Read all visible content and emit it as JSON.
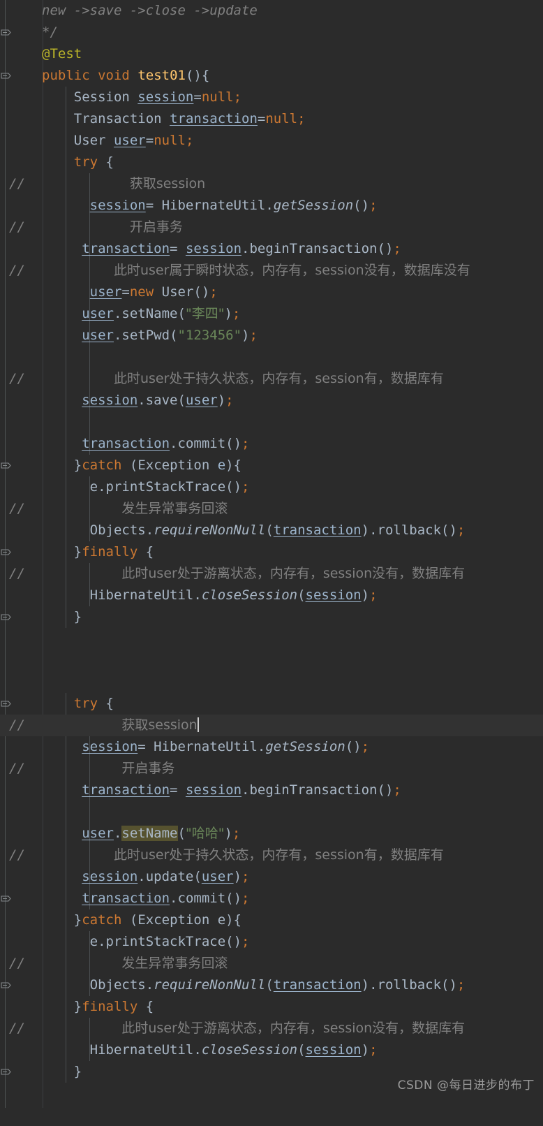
{
  "editor": {
    "theme": "darcula",
    "background": "#2b2b2b",
    "caret_line_background": "#323232",
    "gutter_background": "#2b2b2b",
    "colors": {
      "keyword": "#cc7832",
      "annotation": "#bbb529",
      "method_declaration": "#ffc66d",
      "string": "#6a8759",
      "comment": "#808080",
      "local_variable": "#9cb4cc",
      "default_text": "#a9b7c6",
      "identifier_highlight": "#56522f",
      "indent_guide": "#4b4f51"
    },
    "caret": {
      "line_index": 33,
      "after_text": "获取session"
    },
    "highlighted_identifier": "setName"
  },
  "watermark": {
    "text": "CSDN @每日进步的布丁"
  },
  "comment_markers": {
    "marker": "//",
    "line_indexes": [
      8,
      10,
      12,
      17,
      23,
      26,
      34,
      36,
      39,
      43,
      47
    ]
  },
  "fold_markers": {
    "line_indexes": [
      1,
      3,
      21,
      25,
      28,
      32,
      41,
      45,
      49
    ]
  },
  "lines": [
    {
      "i": 0,
      "indent": 0,
      "plain": "new ->save ->close ->update"
    },
    {
      "i": 1,
      "indent": 0,
      "plain": "*/"
    },
    {
      "i": 2,
      "indent": 0,
      "plain": "@Test"
    },
    {
      "i": 3,
      "indent": 0,
      "plain": "public void test01(){"
    },
    {
      "i": 4,
      "indent": 1,
      "plain": "Session session=null;"
    },
    {
      "i": 5,
      "indent": 1,
      "plain": "Transaction transaction=null;"
    },
    {
      "i": 6,
      "indent": 1,
      "plain": "User user=null;"
    },
    {
      "i": 7,
      "indent": 1,
      "plain": "try {"
    },
    {
      "i": 8,
      "indent": 2,
      "plain": "        获取session"
    },
    {
      "i": 9,
      "indent": 2,
      "plain": " session= HibernateUtil.getSession();"
    },
    {
      "i": 10,
      "indent": 2,
      "plain": "        开启事务"
    },
    {
      "i": 11,
      "indent": 2,
      "plain": "transaction= session.beginTransaction();"
    },
    {
      "i": 12,
      "indent": 2,
      "plain": "      此时user属于瞬时状态，内存有，session没有，数据库没有"
    },
    {
      "i": 13,
      "indent": 2,
      "plain": " user=new User();"
    },
    {
      "i": 14,
      "indent": 2,
      "plain": "user.setName(\"李四\");"
    },
    {
      "i": 15,
      "indent": 2,
      "plain": "user.setPwd(\"123456\");"
    },
    {
      "i": 16,
      "indent": 2,
      "plain": ""
    },
    {
      "i": 17,
      "indent": 2,
      "plain": "      此时user处于持久状态，内存有，session有，数据库有"
    },
    {
      "i": 18,
      "indent": 2,
      "plain": "session.save(user);"
    },
    {
      "i": 19,
      "indent": 2,
      "plain": ""
    },
    {
      "i": 20,
      "indent": 2,
      "plain": "transaction.commit();"
    },
    {
      "i": 21,
      "indent": 1,
      "plain": "}catch (Exception e){"
    },
    {
      "i": 22,
      "indent": 2,
      "plain": "e.printStackTrace();"
    },
    {
      "i": 23,
      "indent": 2,
      "plain": "     发生异常事务回滚"
    },
    {
      "i": 24,
      "indent": 2,
      "plain": "Objects.requireNonNull(transaction).rollback();"
    },
    {
      "i": 25,
      "indent": 1,
      "plain": "}finally {"
    },
    {
      "i": 26,
      "indent": 2,
      "plain": "      此时user处于游离状态，内存有，session没有，数据库有"
    },
    {
      "i": 27,
      "indent": 2,
      "plain": "HibernateUtil.closeSession(session);"
    },
    {
      "i": 28,
      "indent": 1,
      "plain": "}"
    },
    {
      "i": 29,
      "indent": 0,
      "plain": ""
    },
    {
      "i": 30,
      "indent": 0,
      "plain": ""
    },
    {
      "i": 31,
      "indent": 0,
      "plain": ""
    },
    {
      "i": 32,
      "indent": 1,
      "plain": "try {"
    },
    {
      "i": 33,
      "indent": 2,
      "plain": "     获取session"
    },
    {
      "i": 34,
      "indent": 2,
      "plain": "session= HibernateUtil.getSession();"
    },
    {
      "i": 35,
      "indent": 2,
      "plain": "     开启事务"
    },
    {
      "i": 36,
      "indent": 2,
      "plain": "transaction= session.beginTransaction();"
    },
    {
      "i": 37,
      "indent": 2,
      "plain": ""
    },
    {
      "i": 38,
      "indent": 2,
      "plain": "user.setName(\"哈哈\");"
    },
    {
      "i": 39,
      "indent": 2,
      "plain": "     此时user处于持久状态，内存有，session有，数据库有"
    },
    {
      "i": 40,
      "indent": 2,
      "plain": "session.update(user);"
    },
    {
      "i": 41,
      "indent": 2,
      "plain": "transaction.commit();"
    },
    {
      "i": 42,
      "indent": 1,
      "plain": "}catch (Exception e){"
    },
    {
      "i": 43,
      "indent": 2,
      "plain": "e.printStackTrace();"
    },
    {
      "i": 44,
      "indent": 2,
      "plain": "     发生异常事务回滚"
    },
    {
      "i": 45,
      "indent": 2,
      "plain": "Objects.requireNonNull(transaction).rollback();"
    },
    {
      "i": 46,
      "indent": 1,
      "plain": "}finally {"
    },
    {
      "i": 47,
      "indent": 2,
      "plain": "     此时user处于游离状态，内存有，session没有，数据库有"
    },
    {
      "i": 48,
      "indent": 2,
      "plain": "HibernateUtil.closeSession(session);"
    },
    {
      "i": 49,
      "indent": 1,
      "plain": "}"
    }
  ],
  "tokens": {
    "kw_public": "public",
    "kw_void": "void",
    "kw_new": "new",
    "kw_null": "null",
    "kw_try": "try",
    "kw_catch": "catch",
    "kw_finally": "finally",
    "anno_test": "@Test",
    "method_test01": "test01",
    "type_Session": "Session",
    "type_Transaction": "Transaction",
    "type_User": "User",
    "type_Exception": "Exception",
    "cls_HibernateUtil": "HibernateUtil",
    "cls_Objects": "Objects",
    "var_session": "session",
    "var_transaction": "transaction",
    "var_user": "user",
    "var_e": "e",
    "m_getSession": "getSession",
    "m_beginTransaction": "beginTransaction",
    "m_setName": "setName",
    "m_setPwd": "setPwd",
    "m_save": "save",
    "m_update": "update",
    "m_commit": "commit",
    "m_printStackTrace": "printStackTrace",
    "m_requireNonNull": "requireNonNull",
    "m_rollback": "rollback",
    "m_closeSession": "closeSession",
    "str_lisi": "\"李四\"",
    "str_123456": "\"123456\"",
    "str_haha": "\"哈哈\"",
    "cmt_doc_flow": "new ->save ->close ->update",
    "cmt_doc_end": "*/",
    "cmt_get_session": "获取session",
    "cmt_begin_tx": "开启事务",
    "cmt_transient": "此时user属于瞬时状态，内存有，session没有，数据库没有",
    "cmt_persistent": "此时user处于持久状态，内存有，session有，数据库有",
    "cmt_rollback": "发生异常事务回滚",
    "cmt_detached": "此时user处于游离状态，内存有，session没有，数据库有",
    "marker_slashes": "//"
  }
}
